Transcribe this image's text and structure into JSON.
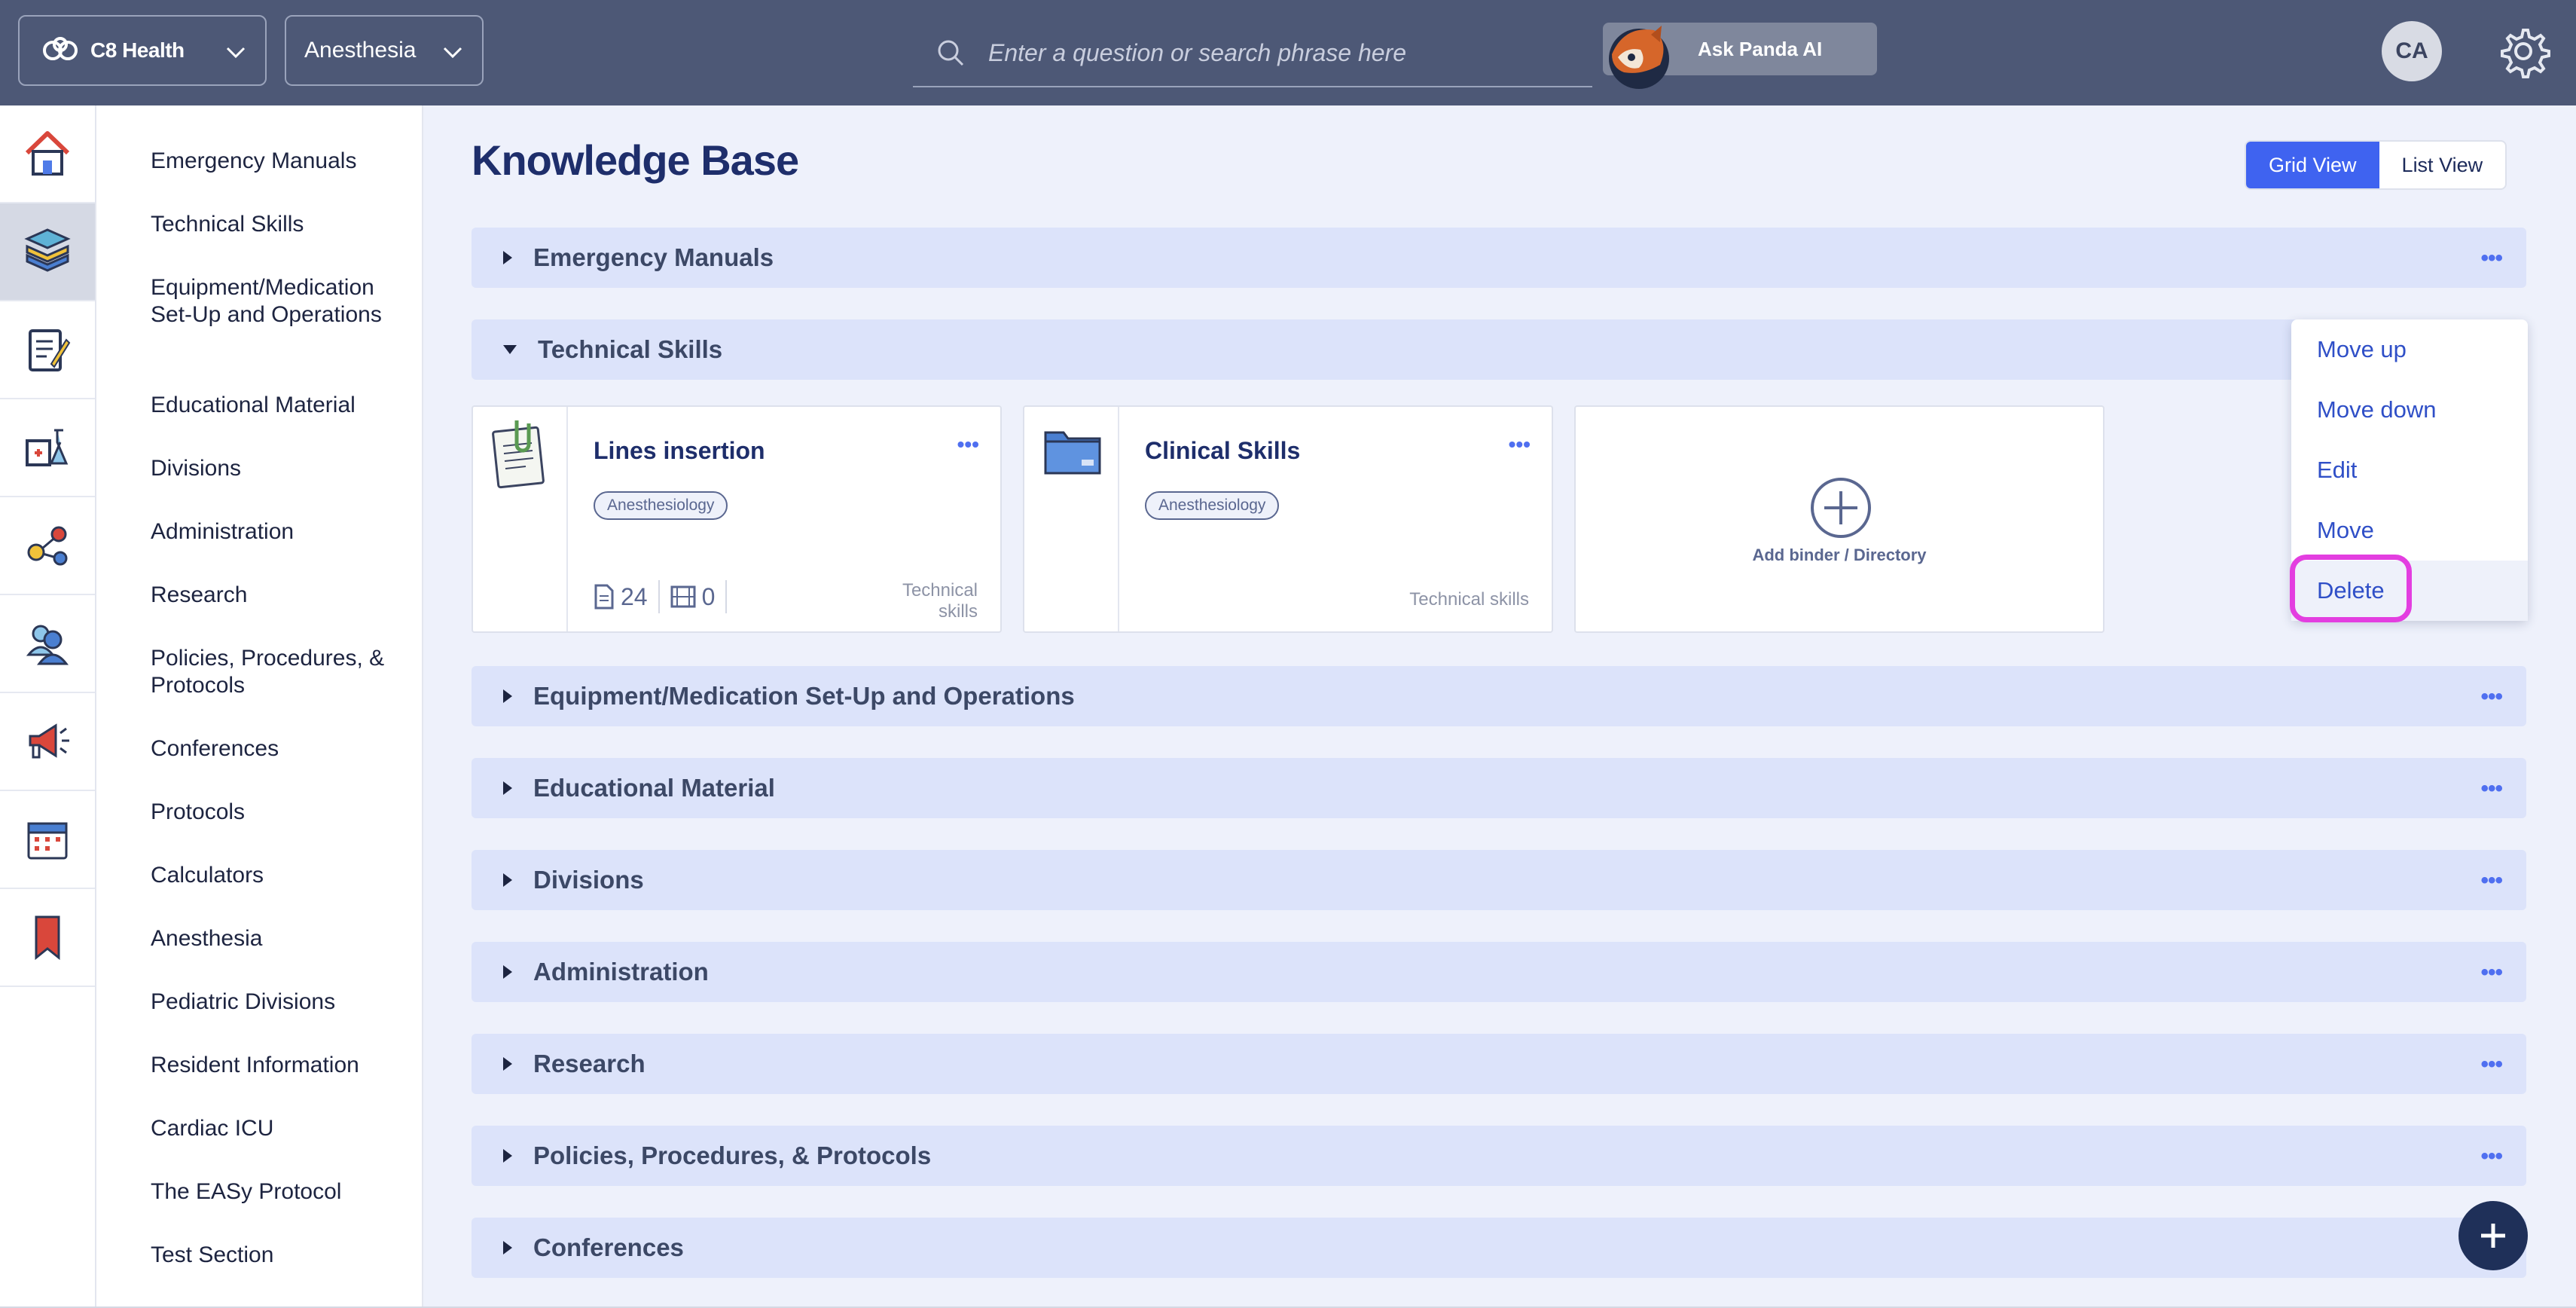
{
  "topbar": {
    "org_name": "C8 Health",
    "specialty": "Anesthesia",
    "search_placeholder": "Enter a question or search phrase here",
    "ask_panda_label": "Ask Panda AI",
    "user_initials": "CA"
  },
  "rail": {
    "items": [
      "home-icon",
      "knowledge-base-icon",
      "checklist-icon",
      "lab-icon",
      "share-icon",
      "users-icon",
      "announcement-icon",
      "calendar-icon",
      "bookmark-icon"
    ],
    "active_index": 1
  },
  "nav": {
    "items": [
      "Emergency Manuals",
      "Technical Skills",
      "Equipment/Medication Set-Up and Operations",
      "Educational Material",
      "Divisions",
      "Administration",
      "Research",
      "Policies, Procedures, & Protocols",
      "Conferences",
      "Protocols",
      "Calculators",
      "Anesthesia",
      "Pediatric Divisions",
      "Resident Information",
      "Cardiac ICU",
      "The EASy Protocol",
      "Test Section"
    ]
  },
  "page": {
    "title": "Knowledge Base",
    "view_toggle": {
      "grid_label": "Grid View",
      "list_label": "List View",
      "active": "grid"
    }
  },
  "sections": [
    {
      "title": "Emergency Manuals",
      "expanded": false
    },
    {
      "title": "Technical Skills",
      "expanded": true
    },
    {
      "title": "Equipment/Medication Set-Up and Operations",
      "expanded": false
    },
    {
      "title": "Educational Material",
      "expanded": false
    },
    {
      "title": "Divisions",
      "expanded": false
    },
    {
      "title": "Administration",
      "expanded": false
    },
    {
      "title": "Research",
      "expanded": false
    },
    {
      "title": "Policies, Procedures, & Protocols",
      "expanded": false
    },
    {
      "title": "Conferences",
      "expanded": false
    }
  ],
  "cards": [
    {
      "title": "Lines insertion",
      "tag": "Anesthesiology",
      "documents": "24",
      "videos": "0",
      "footer_line1": "Technical",
      "footer_line2": "skills"
    },
    {
      "title": "Clinical Skills",
      "tag": "Anesthesiology",
      "footer": "Technical skills"
    }
  ],
  "add_card": {
    "label": "Add binder / Directory"
  },
  "context_menu": {
    "items": [
      "Move up",
      "Move down",
      "Edit",
      "Move",
      "Delete"
    ],
    "highlighted": "Delete"
  },
  "colors": {
    "topbar": "#4d5876",
    "accent": "#3f63f0",
    "section_bg": "#dce3fa",
    "highlight": "#e33ee0",
    "fab": "#1f3059"
  }
}
